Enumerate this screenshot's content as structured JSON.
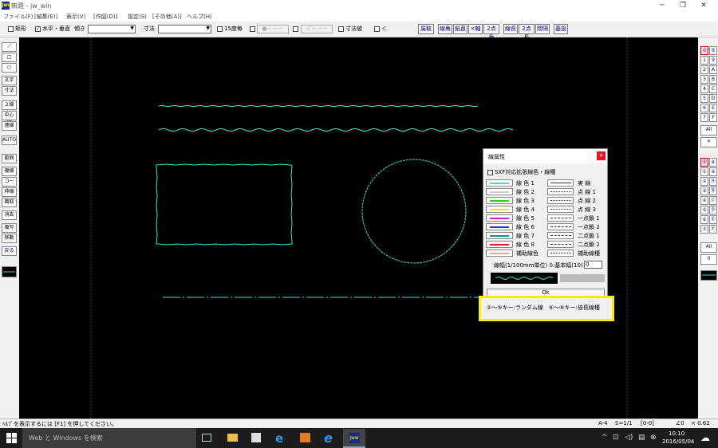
{
  "window": {
    "title": "無題 - jw_win",
    "app_icon": "Jww"
  },
  "menu": [
    "ファイル(F)",
    "[編集(E)]",
    "表示(V)",
    "[作図(D)]",
    "設定(S)",
    "[その他(A)]",
    "ヘルプ(H)"
  ],
  "toolbar": {
    "rect_label": "矩形",
    "hv_label": "水平・垂直",
    "hv_checked": "✓",
    "slope_label": "傾き",
    "dim_label": "寸法",
    "deg15_label": "15度毎",
    "disabled1": "●－－－",
    "disabled2": "＜－－－",
    "dimvalue_label": "寸法値",
    "lt_label": "＜",
    "buttons": [
      "属取",
      "線角",
      "鉛直",
      "×軸",
      "2点角",
      "線長",
      "2点長",
      "間隔",
      "基設"
    ]
  },
  "left_tools": [
    "／",
    "□",
    "○",
    "文字",
    "寸法",
    "２線",
    "中心線",
    "連線",
    "AUTO",
    "範囲",
    "複線",
    "コーナー",
    "伸縮",
    "面取",
    "消去",
    "複写",
    "移動",
    "戻る"
  ],
  "right_tools_top": [
    [
      "0",
      "8"
    ],
    [
      "1",
      "9"
    ],
    [
      "2",
      "A"
    ],
    [
      "3",
      "B"
    ],
    [
      "4",
      "C"
    ],
    [
      "5",
      "D"
    ],
    [
      "6",
      "E"
    ],
    [
      "7",
      "F"
    ]
  ],
  "right_tools_top_extra": [
    "All",
    "✕"
  ],
  "right_tools_bottom": [
    [
      "⓪",
      "⑧"
    ],
    [
      "①",
      "⑨"
    ],
    [
      "②",
      "Ⓐ"
    ],
    [
      "③",
      "Ⓑ"
    ],
    [
      "④",
      "Ⓒ"
    ],
    [
      "⑤",
      "Ⓓ"
    ],
    [
      "⑥",
      "Ⓔ"
    ],
    [
      "⑦",
      "Ⓕ"
    ]
  ],
  "right_tools_bottom_extra": [
    "All",
    "0"
  ],
  "dialog": {
    "title": "線属性",
    "close": "×",
    "sxf_label": "SXF対応拡張線色・線種",
    "check_mark": "✓",
    "colors": [
      {
        "label": "線 色 1",
        "color": "#40e0e0"
      },
      {
        "label": "線 色 2",
        "color": "#ffffff"
      },
      {
        "label": "線 色 3",
        "color": "#22cc22"
      },
      {
        "label": "線 色 4",
        "color": "#e6e600"
      },
      {
        "label": "線 色 5",
        "color": "#cc22cc"
      },
      {
        "label": "線 色 6",
        "color": "#2233dd"
      },
      {
        "label": "線 色 7",
        "color": "#1a8c8c"
      },
      {
        "label": "線 色 8",
        "color": "#cc2222"
      },
      {
        "label": "補助線色",
        "color": "#e8a0a0"
      }
    ],
    "linetypes": [
      "実 線",
      "点 線 1",
      "点 線 2",
      "点 線 3",
      "一点鎖 1",
      "一点鎖 2",
      "二点鎖 1",
      "二点鎖 2",
      "補助線種"
    ],
    "width_label": "線幅(1/100mm単位) 0:基本幅(10)",
    "width_value": "0",
    "ok_label": "Ok",
    "hint": "①～⑤キー:ランダム線　⑥～⑨キー:倍長線種"
  },
  "status": {
    "help": "ﾍﾙﾌﾟを表示するには [F1] を押してください。",
    "paper": "A-4",
    "scale": "S=1/1",
    "layer": "[0-0]",
    "angle": "∠0",
    "zoom": "× 0.62"
  },
  "taskbar": {
    "search_placeholder": "Web と Windows を検索",
    "time": "10:10",
    "date": "2016/05/04"
  }
}
